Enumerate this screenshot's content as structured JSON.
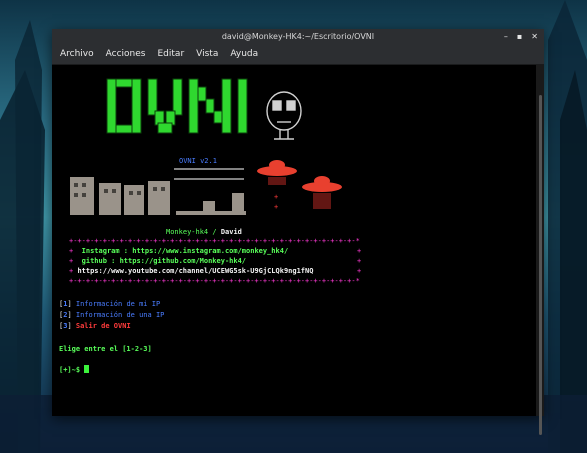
{
  "window": {
    "title": "david@Monkey-HK4:~/Escritorio/OVNI"
  },
  "window_controls": {
    "minimize": "–",
    "maximize": "▪",
    "close": "✕"
  },
  "menu": {
    "items": [
      "Archivo",
      "Acciones",
      "Editar",
      "Vista",
      "Ayuda"
    ]
  },
  "banner": {
    "logo_text": "OVNI",
    "version": "OVNI v2.1"
  },
  "author": {
    "host": "Monkey-hk4",
    "separator": " / ",
    "name": "David"
  },
  "box": {
    "border": "+-+-+-+-+-+-+-+-+-+-+-+-+-+-+-+-+-+-+-+-+-+-+-+-+-+-+-+-+-+-+-+-+-+-*",
    "lines": [
      {
        "prefix": "+",
        "text": "Instagram : https://www.instagram.com/monkey_hk4/",
        "suffix": "+"
      },
      {
        "prefix": "+",
        "text": "github : https://github.com/Monkey-hk4/",
        "suffix": "+"
      },
      {
        "prefix": "+",
        "text": "https://www.youtube.com/channel/UCEWG5sk-U9GjCLQk9ng1fNQ",
        "suffix": "+"
      }
    ]
  },
  "options": [
    {
      "num": "1",
      "label": "Información de mi IP"
    },
    {
      "num": "2",
      "label": "Información de una IP"
    },
    {
      "num": "3",
      "label": "Salir de OVNI"
    }
  ],
  "prompt_text": "Elige entre el [1-2-3]",
  "shell_prompt": "[+]~$",
  "colors": {
    "terminal_bg": "#000000",
    "green": "#59ff5a",
    "magenta": "#ff3ad6",
    "blue": "#4a7dff",
    "red": "#ff3b3b"
  }
}
